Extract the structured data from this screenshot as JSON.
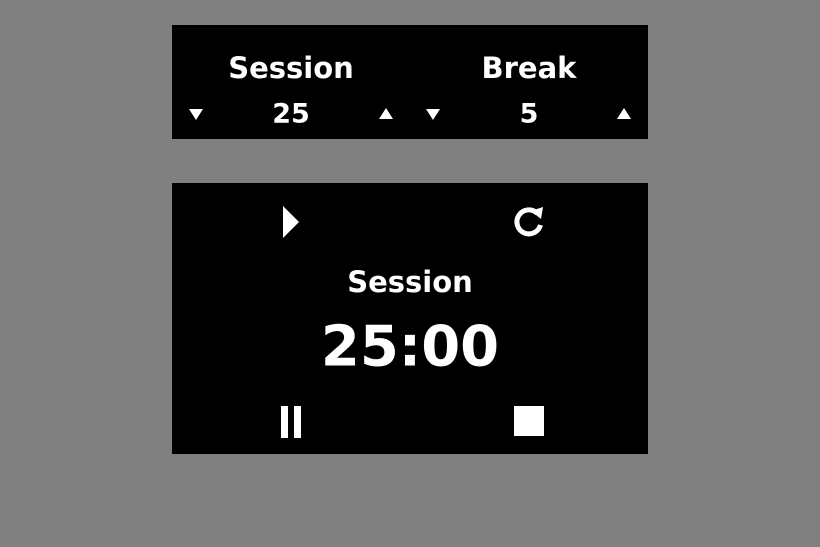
{
  "settings": {
    "session": {
      "title": "Session",
      "value": "25",
      "decrement_icon": "triangle-down-icon",
      "increment_icon": "triangle-up-icon"
    },
    "break": {
      "title": "Break",
      "value": "5",
      "decrement_icon": "triangle-down-icon",
      "increment_icon": "triangle-up-icon"
    }
  },
  "timer": {
    "label": "Session",
    "time": "25:00",
    "controls": {
      "play_icon": "play-icon",
      "reset_icon": "refresh-icon",
      "pause_icon": "pause-icon",
      "stop_icon": "stop-icon"
    }
  },
  "colors": {
    "background": "#808080",
    "panel": "#000000",
    "text": "#ffffff"
  }
}
